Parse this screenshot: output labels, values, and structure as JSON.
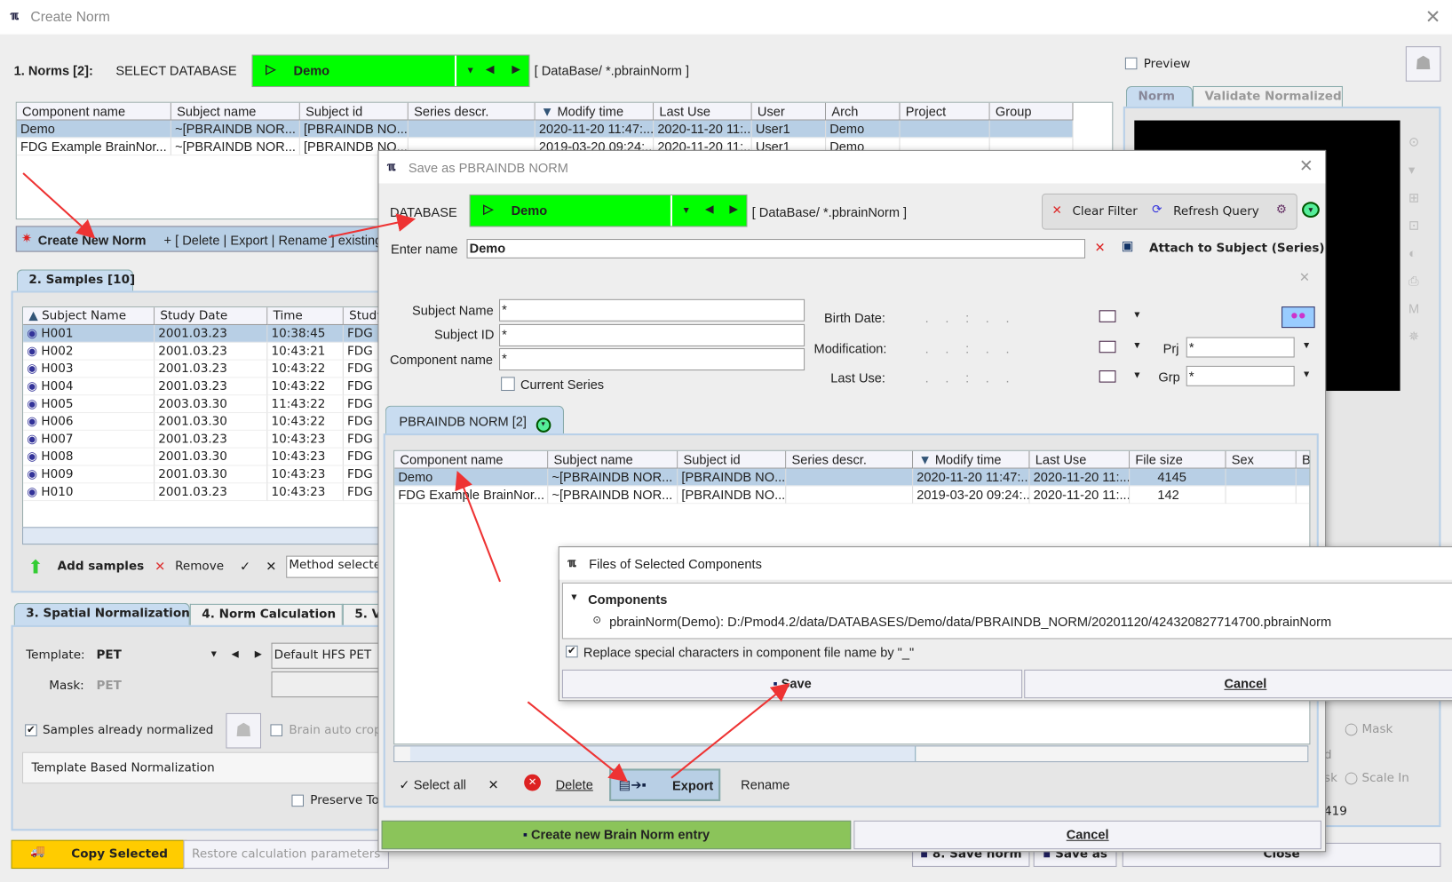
{
  "main": {
    "title": "Create Norm",
    "norms_label": "1. Norms [2]:",
    "select_db": "SELECT DATABASE",
    "db": "Demo",
    "db_path": "[  DataBase/ *.pbrainNorm  ]",
    "preview": "Preview",
    "norms_table": {
      "columns": [
        "Component name",
        "Subject name",
        "Subject id",
        "Series descr.",
        "Modify time",
        "Last Use",
        "User",
        "Arch",
        "Project",
        "Group"
      ],
      "rows": [
        [
          "Demo",
          "~[PBRAINDB NOR...",
          "[PBRAINDB NO...",
          "",
          "2020-11-20 11:47:...",
          "2020-11-20 11:...",
          "User1",
          "Demo",
          "",
          ""
        ],
        [
          "FDG Example BrainNor...",
          "~[PBRAINDB NOR...",
          "[PBRAINDB NO...",
          "",
          "2019-03-20 09:24:...",
          "2020-11-20 11:...",
          "User1",
          "Demo",
          "",
          ""
        ]
      ]
    },
    "create_bar": {
      "create": "Create New Norm",
      "rest": "+ [ Delete | Export | Rename ] existing"
    },
    "samples_tab": "2. Samples [10]",
    "samples_table": {
      "columns": [
        "Subject Name",
        "Study Date",
        "Time",
        "Study"
      ],
      "rows": [
        [
          "H001",
          "2001.03.23",
          "10:38:45",
          "FDG"
        ],
        [
          "H002",
          "2001.03.23",
          "10:43:21",
          "FDG"
        ],
        [
          "H003",
          "2001.03.23",
          "10:43:22",
          "FDG"
        ],
        [
          "H004",
          "2001.03.23",
          "10:43:22",
          "FDG"
        ],
        [
          "H005",
          "2003.03.30",
          "11:43:22",
          "FDG"
        ],
        [
          "H006",
          "2001.03.30",
          "10:43:22",
          "FDG"
        ],
        [
          "H007",
          "2001.03.23",
          "10:43:23",
          "FDG"
        ],
        [
          "H008",
          "2001.03.30",
          "10:43:23",
          "FDG"
        ],
        [
          "H009",
          "2001.03.30",
          "10:43:23",
          "FDG"
        ],
        [
          "H010",
          "2001.03.23",
          "10:43:23",
          "FDG"
        ]
      ]
    },
    "add_samples": "Add samples",
    "remove": "Remove",
    "method": "Method selecte",
    "tabs3": [
      "3. Spatial Normalization",
      "4. Norm Calculation",
      "5. V"
    ],
    "template_label": "Template:",
    "template_value": "PET",
    "template_combo": "Default HFS PET",
    "mask_label": "Mask:",
    "mask_value": "PET",
    "samples_normalized": "Samples already normalized",
    "brain_crop": "Brain auto crop",
    "method_box": "Template Based Normalization",
    "preserve": "Preserve To",
    "copy_selected": "Copy Selected",
    "restore": "Restore calculation parameters",
    "right_tabs": [
      "Norm",
      "Validate Normalized"
    ],
    "mask_radio": "Mask",
    "scale_radio": "Scale In",
    "partial_d": "d",
    "partial_sk": "sk",
    "partial_419": "419",
    "save_norm": "8. Save norm",
    "save_as": "Save as",
    "close": "Close"
  },
  "dialog": {
    "title": "Save as PBRAINDB NORM",
    "db_label": "DATABASE",
    "db": "Demo",
    "db_path": "[  DataBase/ *.pbrainNorm  ]",
    "clear_filter": "Clear Filter",
    "refresh": "Refresh Query",
    "enter_name_label": "Enter name",
    "enter_name": "Demo",
    "attach": "Attach to Subject (Series)",
    "subject_name_label": "Subject Name",
    "subject_name": "*",
    "subject_id_label": "Subject ID",
    "subject_id": "*",
    "component_label": "Component name",
    "component": "*",
    "current_series": "Current Series",
    "birth": "Birth Date:",
    "modification": "Modification:",
    "last_use": "Last Use:",
    "date_mask": ".   .   :   .   .",
    "prj_label": "Prj",
    "prj": "*",
    "grp_label": "Grp",
    "grp": "*",
    "tab": "PBRAINDB NORM [2]",
    "table": {
      "columns": [
        "Component name",
        "Subject name",
        "Subject id",
        "Series descr.",
        "Modify time",
        "Last Use",
        "File size",
        "Sex",
        "B"
      ],
      "rows": [
        [
          "Demo",
          "~[PBRAINDB NOR...",
          "[PBRAINDB NO...",
          "",
          "2020-11-20 11:47:...",
          "2020-11-20 11:...",
          "4145",
          "",
          ""
        ],
        [
          "FDG Example BrainNor...",
          "~[PBRAINDB NOR...",
          "[PBRAINDB NO...",
          "",
          "2019-03-20 09:24:...",
          "2020-11-20 11:...",
          "142",
          "",
          ""
        ]
      ]
    },
    "select_all": "Select all",
    "delete": "Delete",
    "export": "Export",
    "rename": "Rename",
    "create_entry": "Create new Brain Norm entry",
    "cancel": "Cancel"
  },
  "files_dialog": {
    "title": "Files of Selected Components",
    "components": "Components",
    "file": "pbrainNorm(Demo): D:/Pmod4.2/data/DATABASES/Demo/data/PBRAINDB_NORM/20201120/424320827714700.pbrainNorm",
    "replace": "Replace special characters in component file name by \"_\"",
    "save": "Save",
    "cancel": "Cancel"
  },
  "colors": {
    "db_green": "#00ff00",
    "create_green": "#8bc45a",
    "copy_yellow": "#ffcc00",
    "selection": "#b8cfe5",
    "arrow": "#ee3333"
  }
}
